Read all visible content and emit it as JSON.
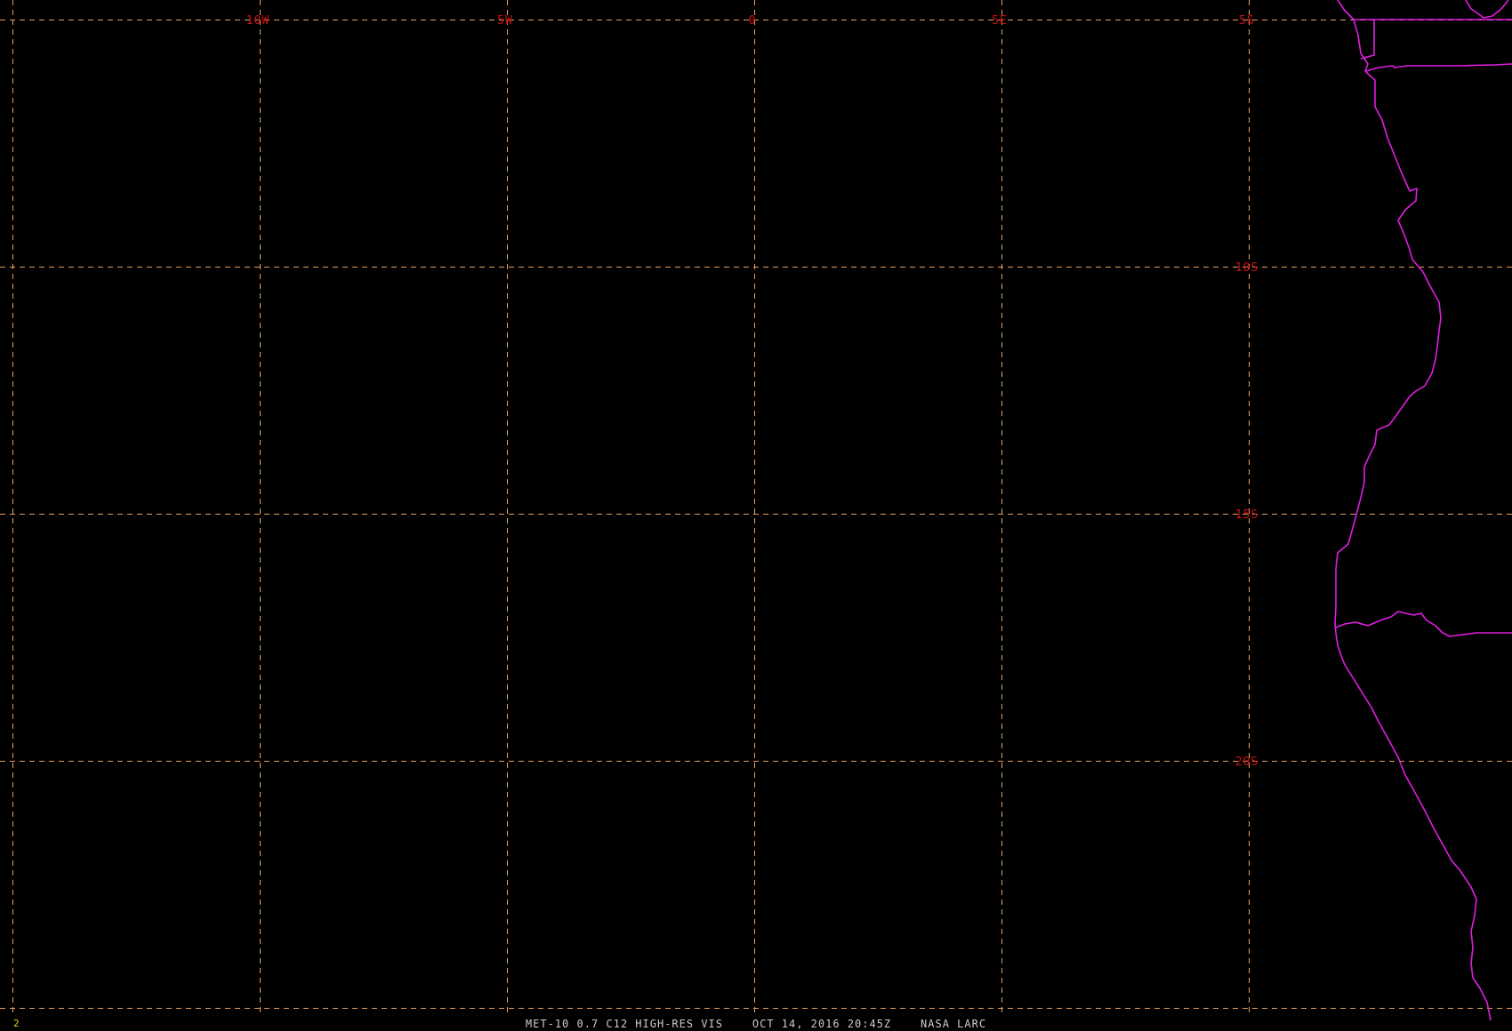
{
  "image": {
    "caption": "MET-10 0.7 C12 HIGH-RES VIS    OCT 14, 2016 20:45Z    NASA LARC",
    "frame_number": "2"
  },
  "graticule": {
    "longitudes": [
      {
        "value": -10,
        "label": "10W"
      },
      {
        "value": -5,
        "label": "5W"
      },
      {
        "value": 0,
        "label": "0"
      },
      {
        "value": 5,
        "label": "5E"
      }
    ],
    "latitudes": [
      {
        "value": -5,
        "label": "5S"
      },
      {
        "value": -10,
        "label": "10S"
      },
      {
        "value": -15,
        "label": "15S"
      },
      {
        "value": -20,
        "label": "20S"
      }
    ]
  },
  "colors": {
    "background": "#000000",
    "grid": "#e8a060",
    "grid_labels": "#cc1111",
    "coastline": "#e01ee0",
    "caption": "#cccccc",
    "frame_number": "#e8c820"
  }
}
